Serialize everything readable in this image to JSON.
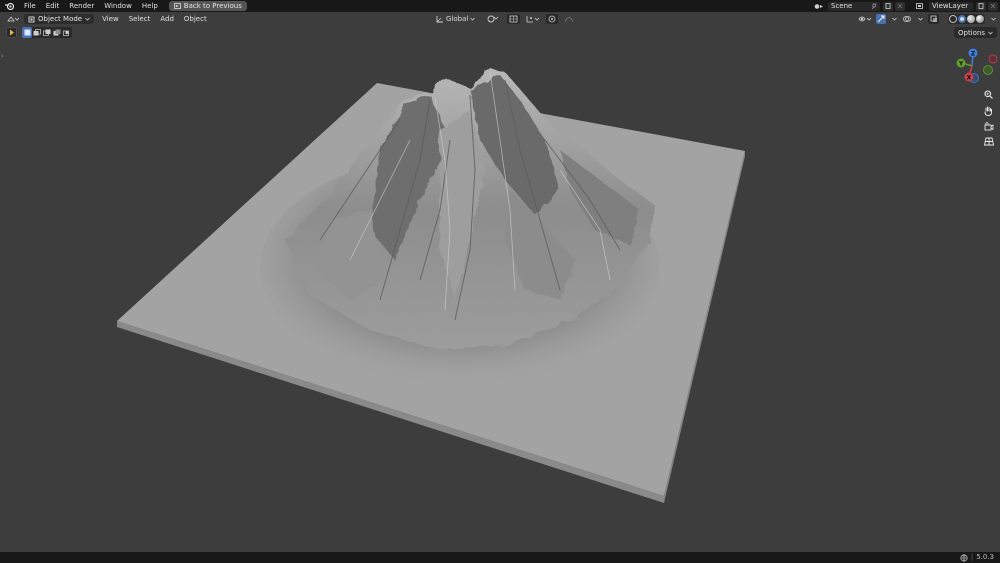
{
  "topbar": {
    "menus": [
      "File",
      "Edit",
      "Render",
      "Window",
      "Help"
    ],
    "back_button": "Back to Previous",
    "scene_label": "Scene",
    "viewlayer_label": "ViewLayer"
  },
  "viewport_header": {
    "mode": "Object Mode",
    "menus": [
      "View",
      "Select",
      "Add",
      "Object"
    ],
    "transform_orientation": "Global"
  },
  "tool_row": {
    "options_label": "Options"
  },
  "gizmo": {
    "z_label": "Z",
    "y_label": "Y",
    "x_label": "X",
    "colors": {
      "x": "#c93f4c",
      "y": "#5f9e2d",
      "z": "#3d7fe3"
    }
  },
  "statusbar": {
    "version": "5.0.3"
  },
  "icons": [
    "blender-logo",
    "back-arrow-icon",
    "scene-icon",
    "pin-icon",
    "viewlayer-icon",
    "cube-icon",
    "transform-pivot-icon",
    "snap-icon",
    "proportional-icon",
    "visibility-icon",
    "gizmo-icon",
    "overlay-icon",
    "xray-icon",
    "zoom-icon",
    "hand-icon",
    "camera-icon",
    "grid-icon",
    "globe-icon"
  ]
}
